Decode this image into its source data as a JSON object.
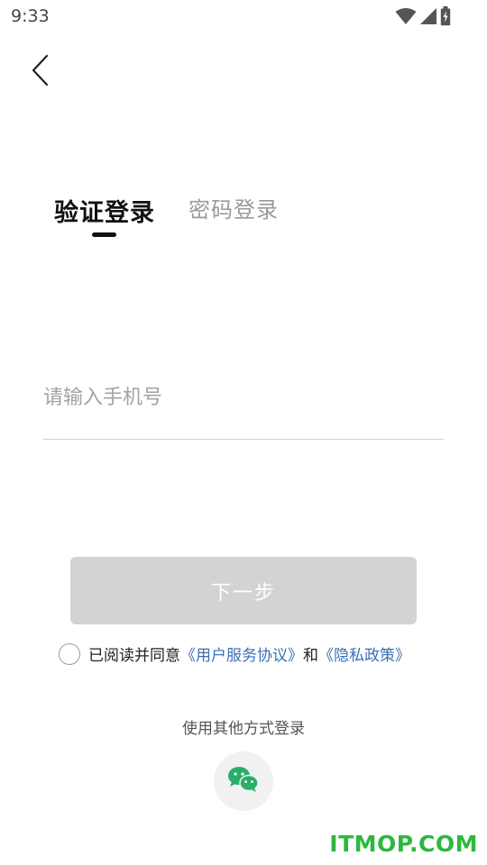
{
  "status_bar": {
    "time": "9:33",
    "icons": [
      "wifi-icon",
      "cell-signal-icon",
      "battery-charging-icon"
    ]
  },
  "nav": {
    "back_icon": "chevron-left-icon"
  },
  "tabs": [
    {
      "label": "验证登录",
      "active": true
    },
    {
      "label": "密码登录",
      "active": false
    }
  ],
  "phone": {
    "placeholder": "请输入手机号",
    "value": ""
  },
  "next_button": {
    "label": "下一步",
    "enabled": false
  },
  "agreement": {
    "checked": false,
    "prefix": "已阅读并同意",
    "user_agreement": "《用户服务协议》",
    "conjunction": "和",
    "privacy_policy": "《隐私政策》"
  },
  "other_login": {
    "label": "使用其他方式登录",
    "wechat_icon": "wechat-icon"
  },
  "watermark": "ITMOP.COM",
  "colors": {
    "accent_link": "#3a6fb5",
    "button_disabled": "#d3d3d3",
    "wechat_green": "#2aae67",
    "watermark_green": "#2db83d"
  }
}
